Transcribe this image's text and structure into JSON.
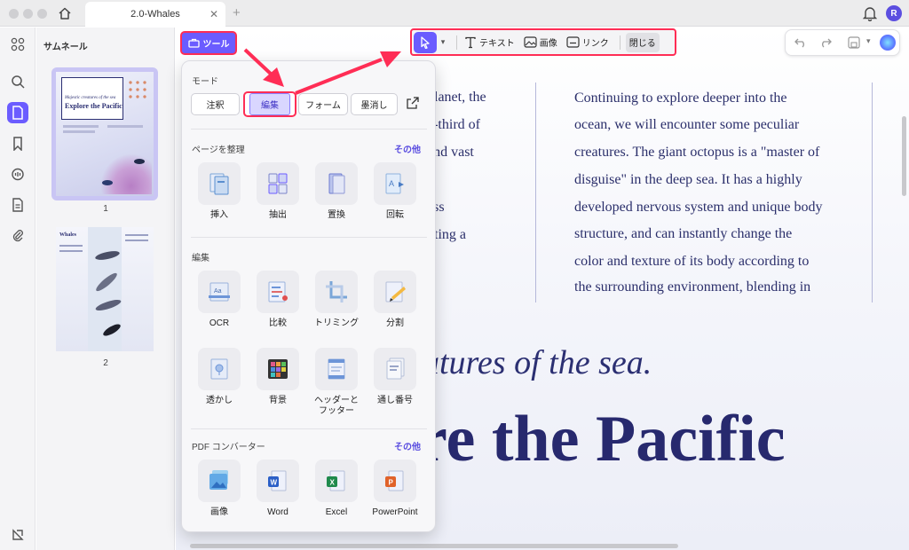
{
  "window": {
    "tab_title": "2.0-Whales",
    "tab_close": "✕",
    "tab_add": "+",
    "avatar_initial": "R"
  },
  "thumbnails": {
    "title": "サムネール",
    "pages": [
      {
        "number": "1",
        "label_line1": "Majestic creatures of the sea",
        "label_line2": "Explore the Pacific"
      },
      {
        "number": "2",
        "label_line1": "Whales"
      }
    ]
  },
  "tools_button": {
    "label": "ツール"
  },
  "edit_toolbar": {
    "text_label": "テキスト",
    "image_label": "画像",
    "link_label": "リンク",
    "close_label": "閉じる"
  },
  "popover": {
    "mode": {
      "title": "モード",
      "buttons": [
        "注釈",
        "編集",
        "フォーム",
        "墨消し"
      ],
      "selected": "編集"
    },
    "organize": {
      "title": "ページを整理",
      "more": "その他",
      "tools": [
        {
          "label": "挿入",
          "icon": "insert-page-icon"
        },
        {
          "label": "抽出",
          "icon": "extract-page-icon"
        },
        {
          "label": "置換",
          "icon": "replace-page-icon"
        },
        {
          "label": "回転",
          "icon": "rotate-page-icon"
        }
      ]
    },
    "edit": {
      "title": "編集",
      "tools_row1": [
        {
          "label": "OCR",
          "icon": "ocr-icon"
        },
        {
          "label": "比較",
          "icon": "compare-icon"
        },
        {
          "label": "トリミング",
          "icon": "crop-icon"
        },
        {
          "label": "分割",
          "icon": "split-icon"
        }
      ],
      "tools_row2": [
        {
          "label": "透かし",
          "icon": "watermark-icon"
        },
        {
          "label": "背景",
          "icon": "background-icon"
        },
        {
          "label": "ヘッダーと",
          "label2": "フッター",
          "icon": "header-footer-icon"
        },
        {
          "label": "通し番号",
          "icon": "bates-number-icon"
        }
      ]
    },
    "converter": {
      "title": "PDF コンバーター",
      "more": "その他",
      "tools": [
        {
          "label": "画像",
          "icon": "image-convert-icon"
        },
        {
          "label": "Word",
          "icon": "word-icon",
          "letter": "W"
        },
        {
          "label": "Excel",
          "icon": "excel-icon",
          "letter": "X"
        },
        {
          "label": "PowerPoint",
          "icon": "powerpoint-icon",
          "letter": "P"
        }
      ]
    }
  },
  "document": {
    "left_column": [
      "planet, the",
      "e-third of",
      "and vast",
      "",
      "ess",
      "uting a",
      "."
    ],
    "right_column": [
      "Continuing to explore deeper into the",
      "ocean, we will encounter some peculiar",
      "creatures. The giant octopus is a \"master of",
      "disguise\" in the deep sea. It has a highly",
      "developed nervous system and unique body",
      "structure, and can instantly change the",
      "color and texture of its body according to",
      "the surrounding environment, blending in"
    ],
    "subtitle": "atures of the sea.",
    "title": "re the Pacific"
  },
  "colors": {
    "accent": "#6b5cff",
    "highlight": "#ff2d55",
    "doc_text": "#2b2f6b"
  }
}
